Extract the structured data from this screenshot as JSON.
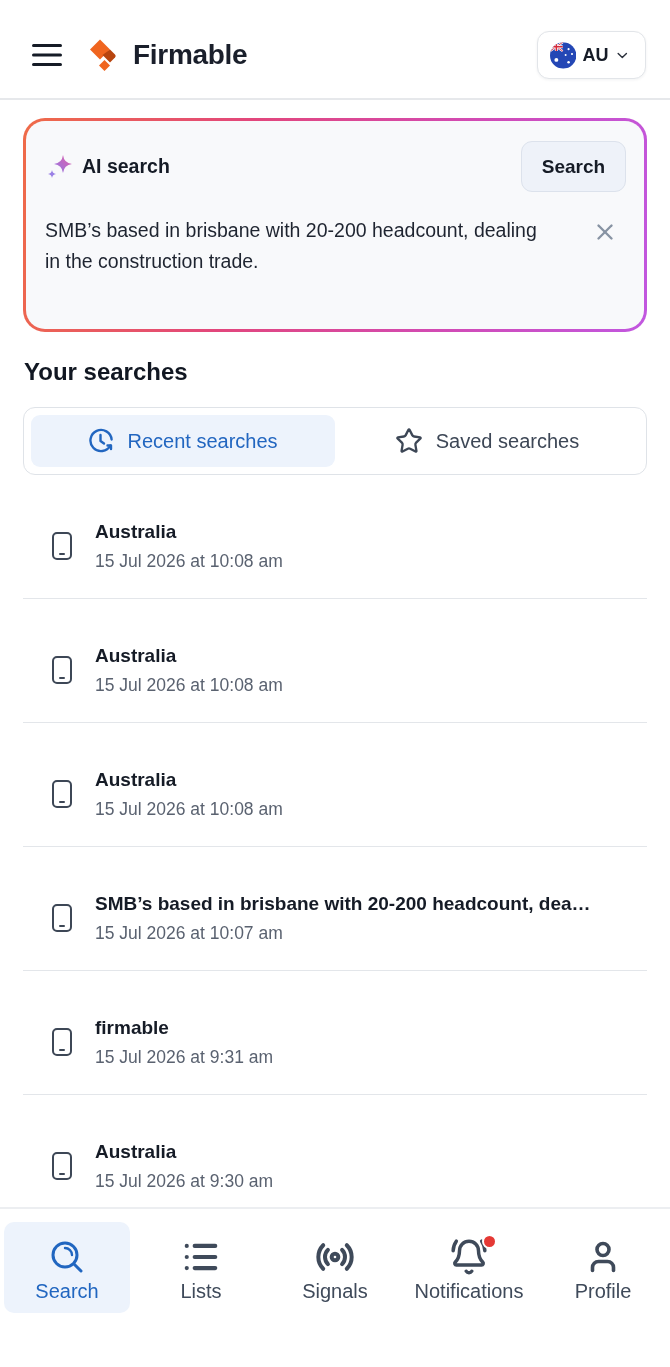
{
  "header": {
    "brand": "Firmable",
    "region": {
      "code": "AU"
    }
  },
  "ai_search": {
    "title": "AI search",
    "button": "Search",
    "query": {
      "value": "SMB’s based in brisbane with 20-200 headcount, dealing in the construction trade."
    }
  },
  "searches": {
    "heading": "Your searches",
    "tabs": [
      {
        "label": "Recent searches",
        "kind": "recent",
        "selected": true
      },
      {
        "label": "Saved searches",
        "kind": "saved",
        "selected": false
      }
    ],
    "items": [
      {
        "title": "Australia",
        "date": "15 Jul 2026 at 10:08 am"
      },
      {
        "title": "Australia",
        "date": "15 Jul 2026 at 10:08 am"
      },
      {
        "title": "Australia",
        "date": "15 Jul 2026 at 10:08 am"
      },
      {
        "title": "SMB’s based in brisbane with 20-200 headcount, dea…",
        "date": "15 Jul 2026 at 10:07 am"
      },
      {
        "title": "firmable",
        "date": "15 Jul 2026 at 9:31 am"
      },
      {
        "title": "Australia",
        "date": "15 Jul 2026 at 9:30 am"
      }
    ]
  },
  "nav": [
    {
      "label": "Search",
      "kind": "search",
      "selected": true,
      "alert": false
    },
    {
      "label": "Lists",
      "kind": "lists",
      "selected": false,
      "alert": false
    },
    {
      "label": "Signals",
      "kind": "signals",
      "selected": false,
      "alert": false
    },
    {
      "label": "Notifications",
      "kind": "notifications",
      "selected": false,
      "alert": true
    },
    {
      "label": "Profile",
      "kind": "profile",
      "selected": false,
      "alert": false
    }
  ]
}
